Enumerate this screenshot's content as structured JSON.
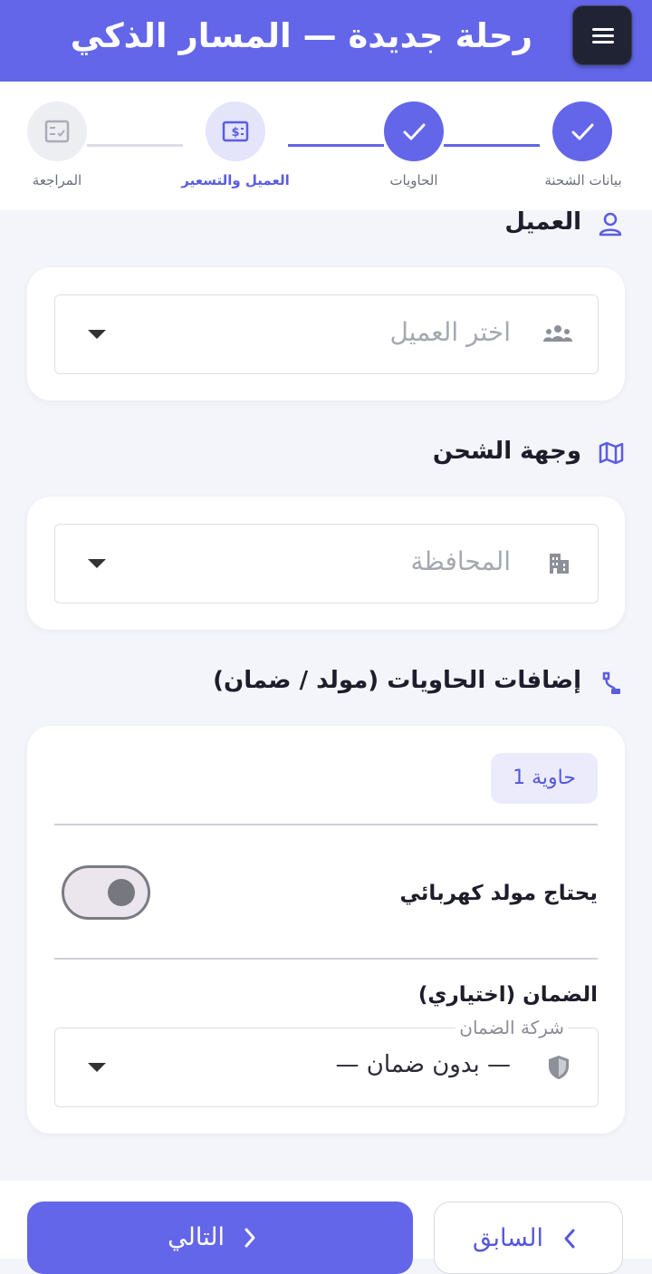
{
  "header": {
    "title": "رحلة جديدة — المسار الذكي",
    "menu_icon": "menu-icon",
    "background": "#6366e9"
  },
  "stepper": {
    "steps": [
      {
        "label": "بيانات الشحنة",
        "state": "done",
        "icon": "check-icon"
      },
      {
        "label": "الحاويات",
        "state": "done",
        "icon": "check-icon"
      },
      {
        "label": "العميل والتسعير",
        "state": "current",
        "icon": "invoice-dollar-icon"
      },
      {
        "label": "المراجعة",
        "state": "todo",
        "icon": "checklist-icon"
      }
    ]
  },
  "customer_section": {
    "title": "العميل",
    "icon": "user-icon",
    "select": {
      "placeholder": "اختر العميل",
      "icon": "group-icon"
    }
  },
  "destination_section": {
    "title": "وجهة الشحن",
    "icon": "map-icon",
    "select": {
      "placeholder": "المحافظة",
      "icon": "city-icon"
    }
  },
  "addons_section": {
    "title": "إضافات الحاويات (مولد / ضمان)",
    "icon": "plug-icon",
    "container": {
      "badge": "حاوية 1",
      "generator_label": "يحتاج مولد كهربائي",
      "generator_enabled": false,
      "insurance_label": "الضمان (اختياري)",
      "insurance_field_label": "شركة الضمان",
      "insurance_value": "— بدون ضمان —",
      "insurance_icon": "shield-icon"
    }
  },
  "footer": {
    "next_label": "التالي",
    "prev_label": "السابق"
  },
  "colors": {
    "accent": "#6366e9",
    "accent_light": "#e4e4fb",
    "page_bg": "#f4f5fb"
  }
}
